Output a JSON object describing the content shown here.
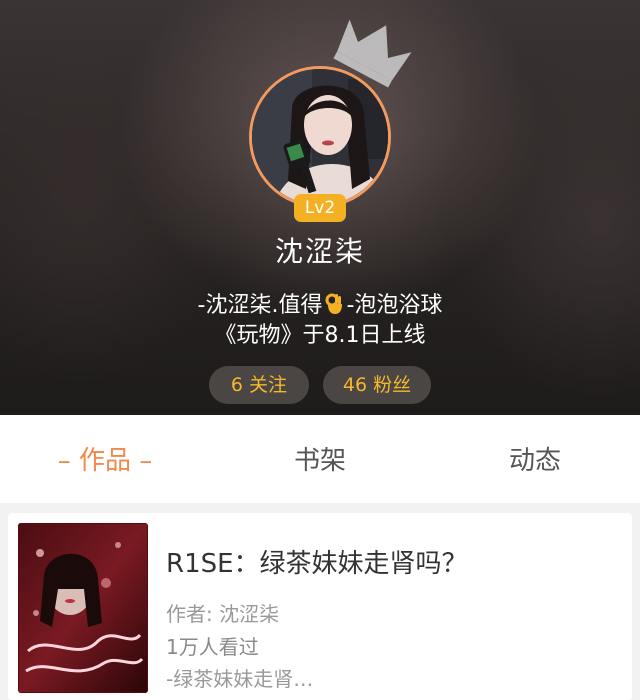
{
  "profile": {
    "level": "Lv2",
    "username": "沈涩柒",
    "bio_line1_prefix": "-沈涩柒.值得",
    "bio_line1_emoji": "ok-hand-icon",
    "bio_line1_suffix": "-泡泡浴球",
    "bio_line2": "《玩物》于8.1日上线",
    "follow_label": "6 关注",
    "fans_label": "46 粉丝"
  },
  "tabs": [
    {
      "label": "– 作品 –",
      "active": true
    },
    {
      "label": "书架",
      "active": false
    },
    {
      "label": "动态",
      "active": false
    }
  ],
  "works": [
    {
      "title": "R1SE：绿茶妹妹走肾吗？",
      "author": "作者: 沈涩柒",
      "views": "1万人看过",
      "description": "-绿茶妹妹走肾…"
    }
  ],
  "colors": {
    "accent": "#f08a4b",
    "level_badge": "#f3b023",
    "stat_text": "#f5b82c"
  }
}
